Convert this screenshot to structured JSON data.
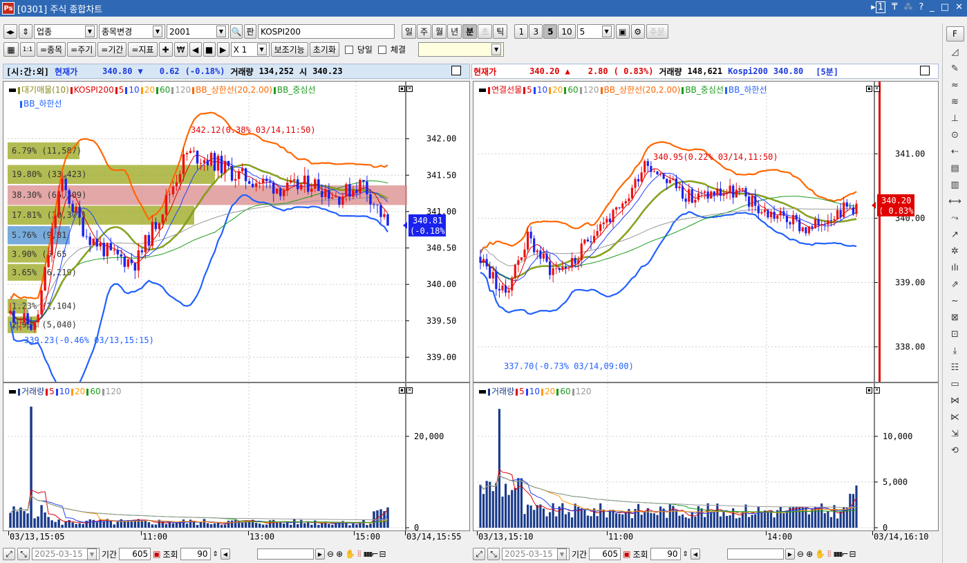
{
  "window": {
    "title": "[0301] 주식 종합차트",
    "ctrl_page": "1"
  },
  "toolbar1": {
    "market_select": "업종",
    "change_btn": "종목변경",
    "code_value": "2001",
    "board_label": "판",
    "name_value": "KOSPI200",
    "period_buttons": [
      "일",
      "주",
      "월",
      "년",
      "분",
      "초",
      "틱"
    ],
    "period_selected": "분",
    "interval_buttons": [
      "1",
      "3",
      "5",
      "10"
    ],
    "interval_selected": "5",
    "interval_value": "5",
    "order_btn": "주문"
  },
  "toolbar2": {
    "grid_btn": "▦",
    "onetoone_btn": "1:1",
    "item_btn": "=종목",
    "cycle_btn": "=주기",
    "period_btn": "=기간",
    "indicator_btn": "=지표",
    "multiplier": "X 1",
    "aux_btn": "보조기능",
    "reset_btn": "초기화",
    "today_label": "당일",
    "trade_label": "체결"
  },
  "left": {
    "info": {
      "session": "[시:간:외]",
      "price_label": "현재가",
      "price": "340.80",
      "arrow": "▼",
      "change": "0.62",
      "change_pct": "(-0.18%)",
      "volume_label": "거래량",
      "volume": "134,252",
      "open_label": "시",
      "open": "340.23"
    },
    "price_legend": {
      "items": [
        {
          "text": "대기매물(10)",
          "color": "#8a8a1a"
        },
        {
          "text": "KOSPI200",
          "color": "#e00000"
        },
        {
          "text": "5",
          "color": "#e00000"
        },
        {
          "text": "10",
          "color": "#2040ff"
        },
        {
          "text": "20",
          "color": "#ff9900"
        },
        {
          "text": "60",
          "color": "#1a9a1a"
        },
        {
          "text": "120",
          "color": "#999999"
        },
        {
          "text": "BB_상한선(20,2.00)",
          "color": "#ff6600"
        },
        {
          "text": "BB_중심선",
          "color": "#1a9a1a"
        }
      ],
      "second_line": {
        "text": "BB_하한선",
        "color": "#2060ff"
      }
    },
    "price_axis": [
      "342.00",
      "341.50",
      "341.00",
      "340.50",
      "340.00",
      "339.50",
      "339.00"
    ],
    "price_tag": {
      "line1": "340.81",
      "line2": "(-0.18%)"
    },
    "annot_high": "342.12(0.38% 03/14,11:50)",
    "annot_low": "339.23(-0.46% 03/13,15:15)",
    "volume_profile": [
      {
        "label": "6.79% (11,587)"
      },
      {
        "label": "19.80% (33,423)"
      },
      {
        "label": "38.30% (65,309)"
      },
      {
        "label": "17.81% (30,377)"
      },
      {
        "label": "5.76% (9,81"
      },
      {
        "label": "3.90% (6,65"
      },
      {
        "label": "3.65% (6,219)"
      },
      {
        "label": "1.23% (2,104)"
      },
      {
        "label": "2.95% (5,040)"
      }
    ],
    "volume_legend": {
      "items": [
        {
          "text": "거래량",
          "color": "#1a3a8a"
        },
        {
          "text": "5",
          "color": "#e00000"
        },
        {
          "text": "10",
          "color": "#2040ff"
        },
        {
          "text": "20",
          "color": "#ff9900"
        },
        {
          "text": "60",
          "color": "#1a9a1a"
        },
        {
          "text": "120",
          "color": "#999999"
        }
      ]
    },
    "volume_axis": [
      "20,000",
      "0"
    ],
    "time_axis": [
      "03/13,15:05",
      "11:00",
      "13:00",
      "15:00",
      "03/14,15:55"
    ],
    "bottom": {
      "date": "2025-03-15",
      "period_label": "기간",
      "period_value": "605",
      "query_label": "조회",
      "query_value": "90"
    }
  },
  "right": {
    "info": {
      "price_label": "현재가",
      "price": "340.20",
      "arrow": "▲",
      "change": "2.80",
      "change_pct": "( 0.83%)",
      "volume_label": "거래량",
      "volume": "148,621",
      "index_label": "Kospi200",
      "index_value": "340.80",
      "interval": "[5분]"
    },
    "price_legend": {
      "items": [
        {
          "text": "연결선물",
          "color": "#e00000"
        },
        {
          "text": "5",
          "color": "#e00000"
        },
        {
          "text": "10",
          "color": "#2040ff"
        },
        {
          "text": "20",
          "color": "#ff9900"
        },
        {
          "text": "60",
          "color": "#1a9a1a"
        },
        {
          "text": "120",
          "color": "#999999"
        },
        {
          "text": "BB_상한선(20,2.00)",
          "color": "#ff6600"
        },
        {
          "text": "BB_중심선",
          "color": "#1a9a1a"
        },
        {
          "text": "BB_하한선",
          "color": "#2060ff"
        }
      ]
    },
    "price_axis": [
      "341.00",
      "340.00",
      "339.00",
      "338.00"
    ],
    "price_tag": {
      "line1": "340.20",
      "line2": "( 0.83%)"
    },
    "annot_high": "340.95(0.22% 03/14,11:50)",
    "annot_low": "337.70(-0.73% 03/14,09:00)",
    "volume_legend": {
      "items": [
        {
          "text": "거래량",
          "color": "#1a3a8a"
        },
        {
          "text": "5",
          "color": "#e00000"
        },
        {
          "text": "10",
          "color": "#2040ff"
        },
        {
          "text": "20",
          "color": "#ff9900"
        },
        {
          "text": "60",
          "color": "#1a9a1a"
        },
        {
          "text": "120",
          "color": "#999999"
        }
      ]
    },
    "volume_axis": [
      "10,000",
      "5,000",
      "0"
    ],
    "time_axis": [
      "03/13,15:10",
      "11:00",
      "14:00",
      "03/14,16:10"
    ],
    "bottom": {
      "date": "2025-03-15",
      "period_label": "기간",
      "period_value": "605",
      "query_label": "조회",
      "query_value": "90"
    }
  },
  "sidebar": {
    "top_btn": "F",
    "icons": [
      "chart-type-icon",
      "tools-icon",
      "price-icon",
      "trade-icon",
      "scale-icon",
      "zoom-icon",
      "drag-icon",
      "doc-icon",
      "doc2-icon",
      "arrange-icon",
      "auto-icon",
      "trend-icon",
      "pattern-icon",
      "bar-icon",
      "line-icon",
      "wave-icon",
      "compare-icon",
      "compare2-icon",
      "download-icon",
      "list-icon",
      "window-icon",
      "stack-icon",
      "stack2-icon",
      "export-icon",
      "refresh-icon"
    ]
  },
  "colors": {
    "up": "#ee1111",
    "down": "#1a22ee",
    "title_bg": "#2f69b5",
    "info_bg": "#d7e6f5"
  }
}
